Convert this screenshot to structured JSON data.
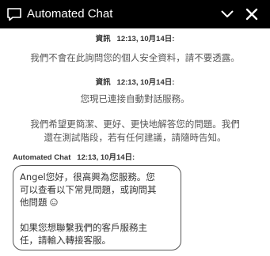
{
  "header": {
    "title": "Automated Chat",
    "icons": {
      "chat": "chat-bubble-icon",
      "minimize": "chevron-down-icon",
      "close": "close-icon"
    }
  },
  "messages": {
    "system_1": {
      "sender": "資訊",
      "timestamp": "12:13, 10月14日:",
      "text": "我們不會在此詢問您的個人安全資料，請不要透露。"
    },
    "system_2": {
      "sender": "資訊",
      "timestamp": "12:13, 10月14日:",
      "text_line_1": "您現已連接自動對話服務。",
      "text_line_2": "我們希望更簡潔、更好、更快地解答您的問題。我們",
      "text_line_3": "還在測試階段，若有任何建議，請隨時告知。"
    },
    "bot_1": {
      "sender": "Automated Chat",
      "timestamp": "12:13, 10月14日:",
      "line_1": "Angel您好，很高興為您服務。您",
      "line_2": "可以查看以下常見問題，或詢問其",
      "line_3": "他問題",
      "line_4": "如果您想聯繫我們的客戶服務主",
      "line_5": "任，請輸入轉接客服。",
      "emoji": "smile-icon"
    }
  },
  "colors": {
    "header_bg": "#000000",
    "header_text": "#ffffff",
    "body_text": "#333333",
    "muted_text": "#555555",
    "bubble_border": "#555555"
  }
}
